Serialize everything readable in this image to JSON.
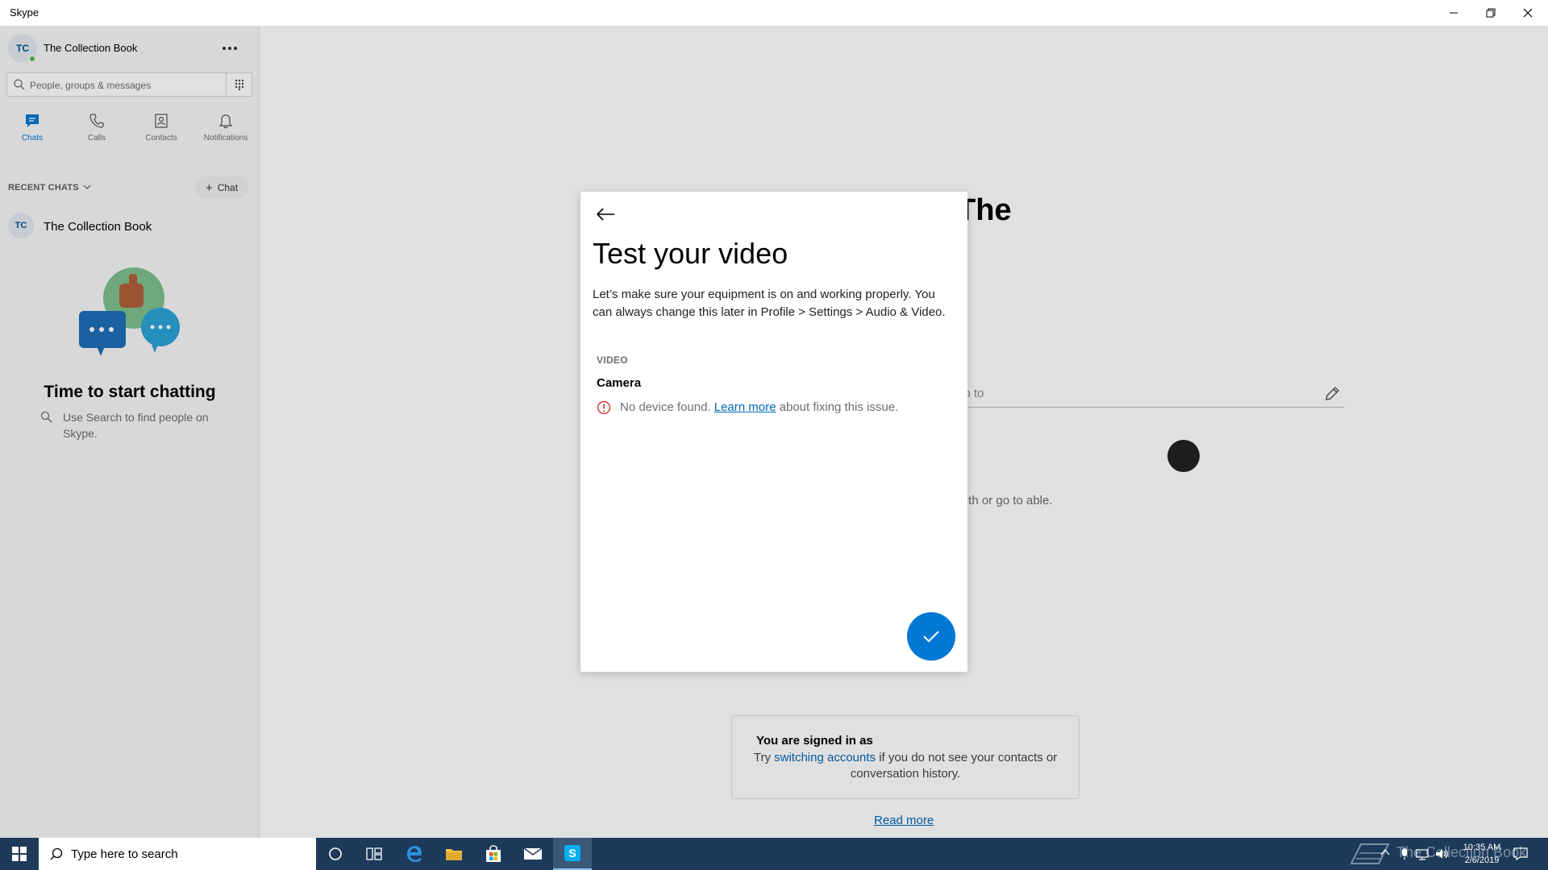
{
  "window": {
    "title": "Skype"
  },
  "sidebar": {
    "profile": {
      "initials": "TC",
      "name": "The Collection Book"
    },
    "search": {
      "placeholder": "People, groups & messages"
    },
    "tabs": [
      {
        "label": "Chats",
        "icon": "chat-icon",
        "active": true
      },
      {
        "label": "Calls",
        "icon": "phone-icon",
        "active": false
      },
      {
        "label": "Contacts",
        "icon": "contacts-icon",
        "active": false
      },
      {
        "label": "Notifications",
        "icon": "bell-icon",
        "active": false
      }
    ],
    "recent_header": "RECENT CHATS",
    "new_chat_label": "Chat",
    "recent_chats": [
      {
        "initials": "TC",
        "name": "The Collection Book"
      }
    ],
    "empty_state": {
      "headline": "Time to start chatting",
      "hint": "Use Search to find people on Skype."
    }
  },
  "background": {
    "heading_fragment": "The",
    "field_fragment": "up to",
    "text_fragment": "with or go to able.",
    "signed_in": {
      "title": "You are signed in as",
      "prefix": "Try ",
      "link": "switching accounts",
      "suffix": " if you do not see your contacts or conversation history."
    },
    "read_more": "Read more"
  },
  "modal": {
    "title": "Test your video",
    "description": "Let’s make sure your equipment is on and working properly. You can always change this later in Profile > Settings > Audio & Video.",
    "section_label": "VIDEO",
    "camera_label": "Camera",
    "error": {
      "prefix": "No device found. ",
      "link": "Learn more",
      "suffix": " about fixing this issue."
    }
  },
  "taskbar": {
    "search_placeholder": "Type here to search",
    "time": "10:35 AM",
    "date": "2/6/2019",
    "watermark": "The Collection Book"
  },
  "colors": {
    "accent": "#0078d4",
    "link": "#0067b8",
    "presence": "#5bb75b",
    "error": "#d13438",
    "taskbar": "#1e3a5a"
  }
}
